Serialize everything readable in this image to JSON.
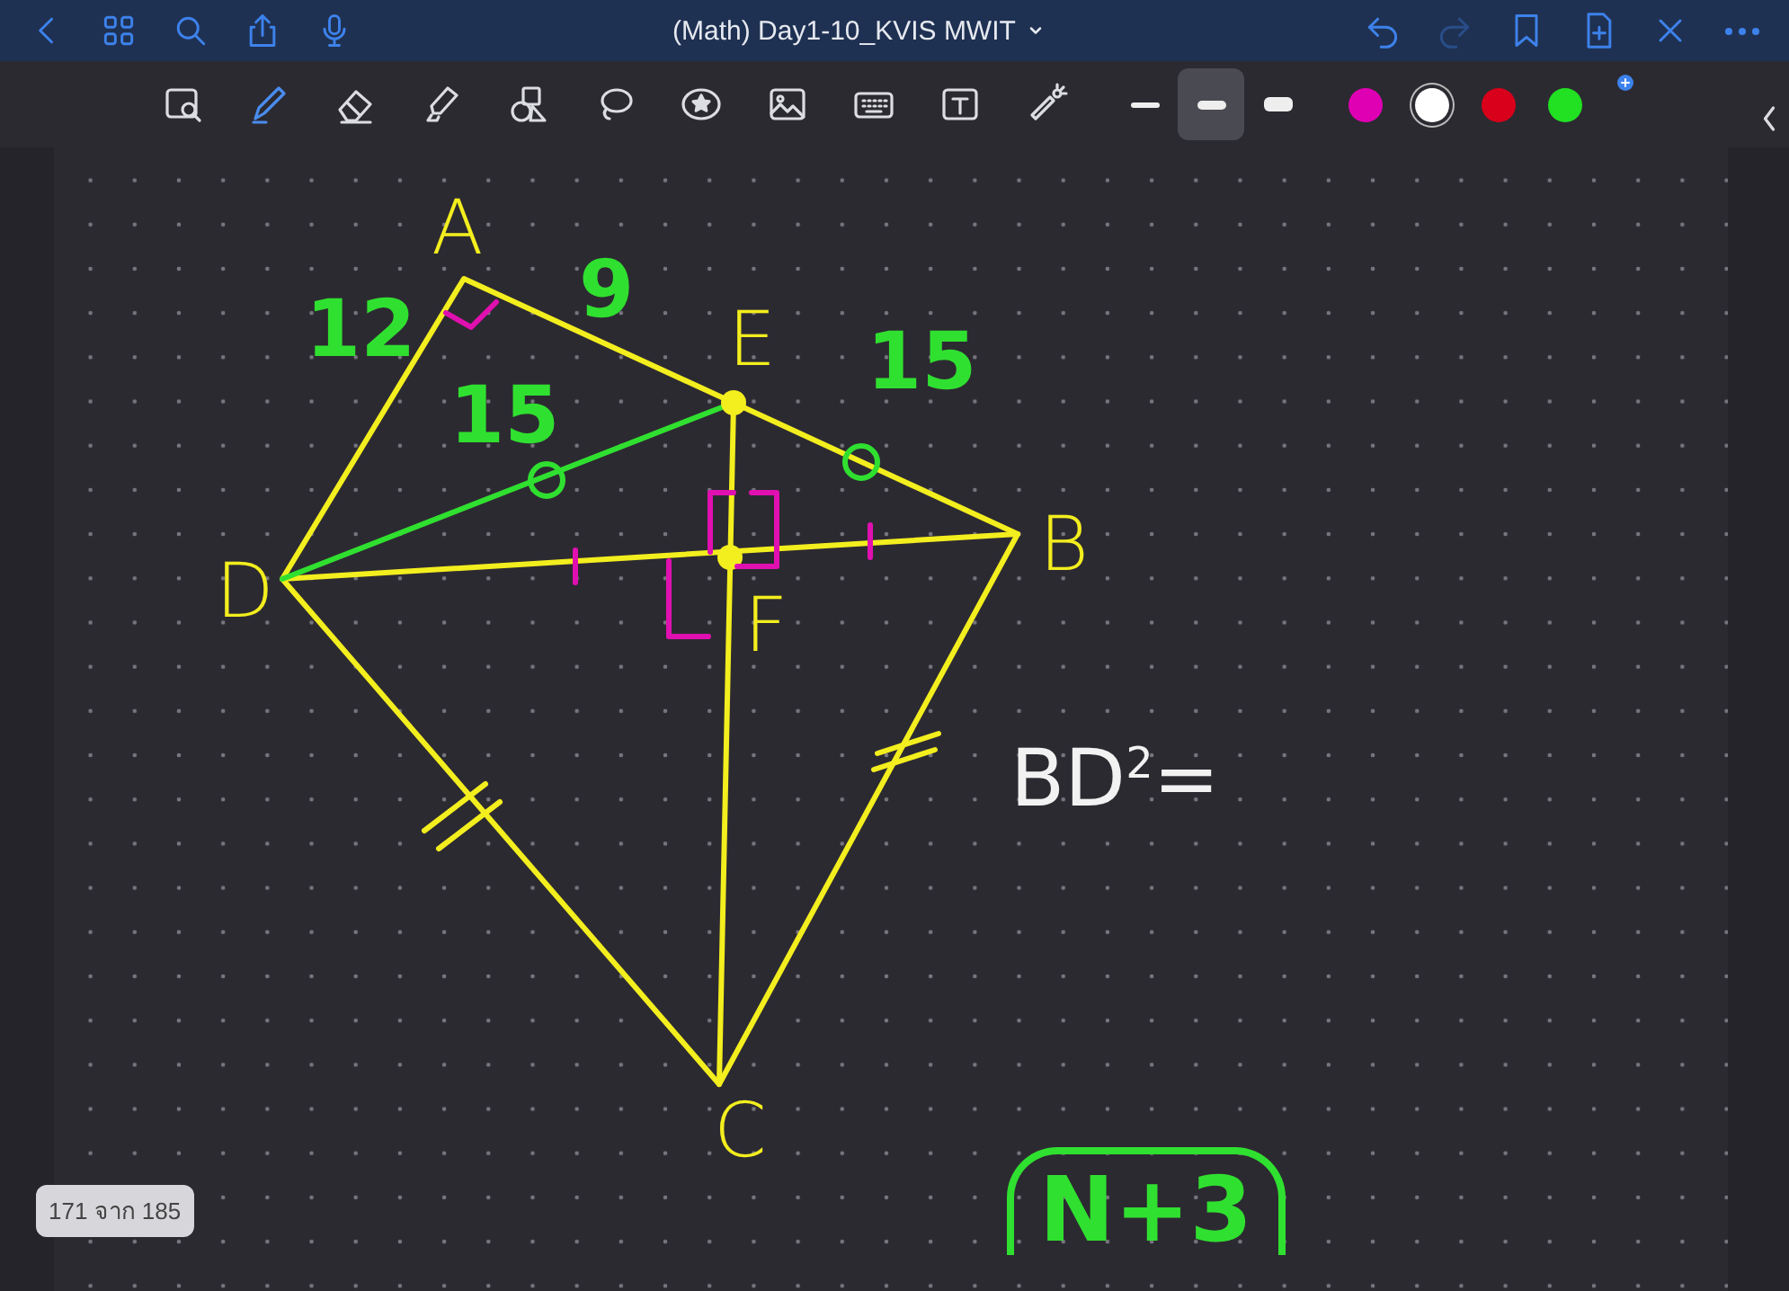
{
  "window": {
    "title": "(Math) Day1-10_KVIS MWIT"
  },
  "tools": [
    {
      "kind": "zoom",
      "selected": false
    },
    {
      "kind": "pen",
      "selected": true
    },
    {
      "kind": "eraser",
      "selected": false
    },
    {
      "kind": "highlighter",
      "selected": false
    },
    {
      "kind": "shapes",
      "selected": false
    },
    {
      "kind": "lasso",
      "selected": false
    },
    {
      "kind": "sticker",
      "selected": false
    },
    {
      "kind": "image",
      "selected": false
    },
    {
      "kind": "keyboard",
      "selected": false
    },
    {
      "kind": "text",
      "selected": false
    },
    {
      "kind": "laser",
      "selected": false
    }
  ],
  "stroke_widths": [
    {
      "selected": false
    },
    {
      "selected": true
    },
    {
      "selected": false
    }
  ],
  "colors": [
    {
      "color": "#e000b4",
      "selected": false
    },
    {
      "color": "#ffffff",
      "selected": true
    },
    {
      "color": "#d8001a",
      "selected": false
    },
    {
      "color": "#22e022",
      "selected": false
    }
  ],
  "diagram": {
    "vertex_labels": [
      "A",
      "E",
      "B",
      "D",
      "F",
      "C"
    ],
    "measurements": [
      "12",
      "9",
      "15",
      "15"
    ],
    "note": "BD$^{2}$=",
    "boxed_note": "N+3"
  },
  "page_indicator": "171 จาก 185"
}
